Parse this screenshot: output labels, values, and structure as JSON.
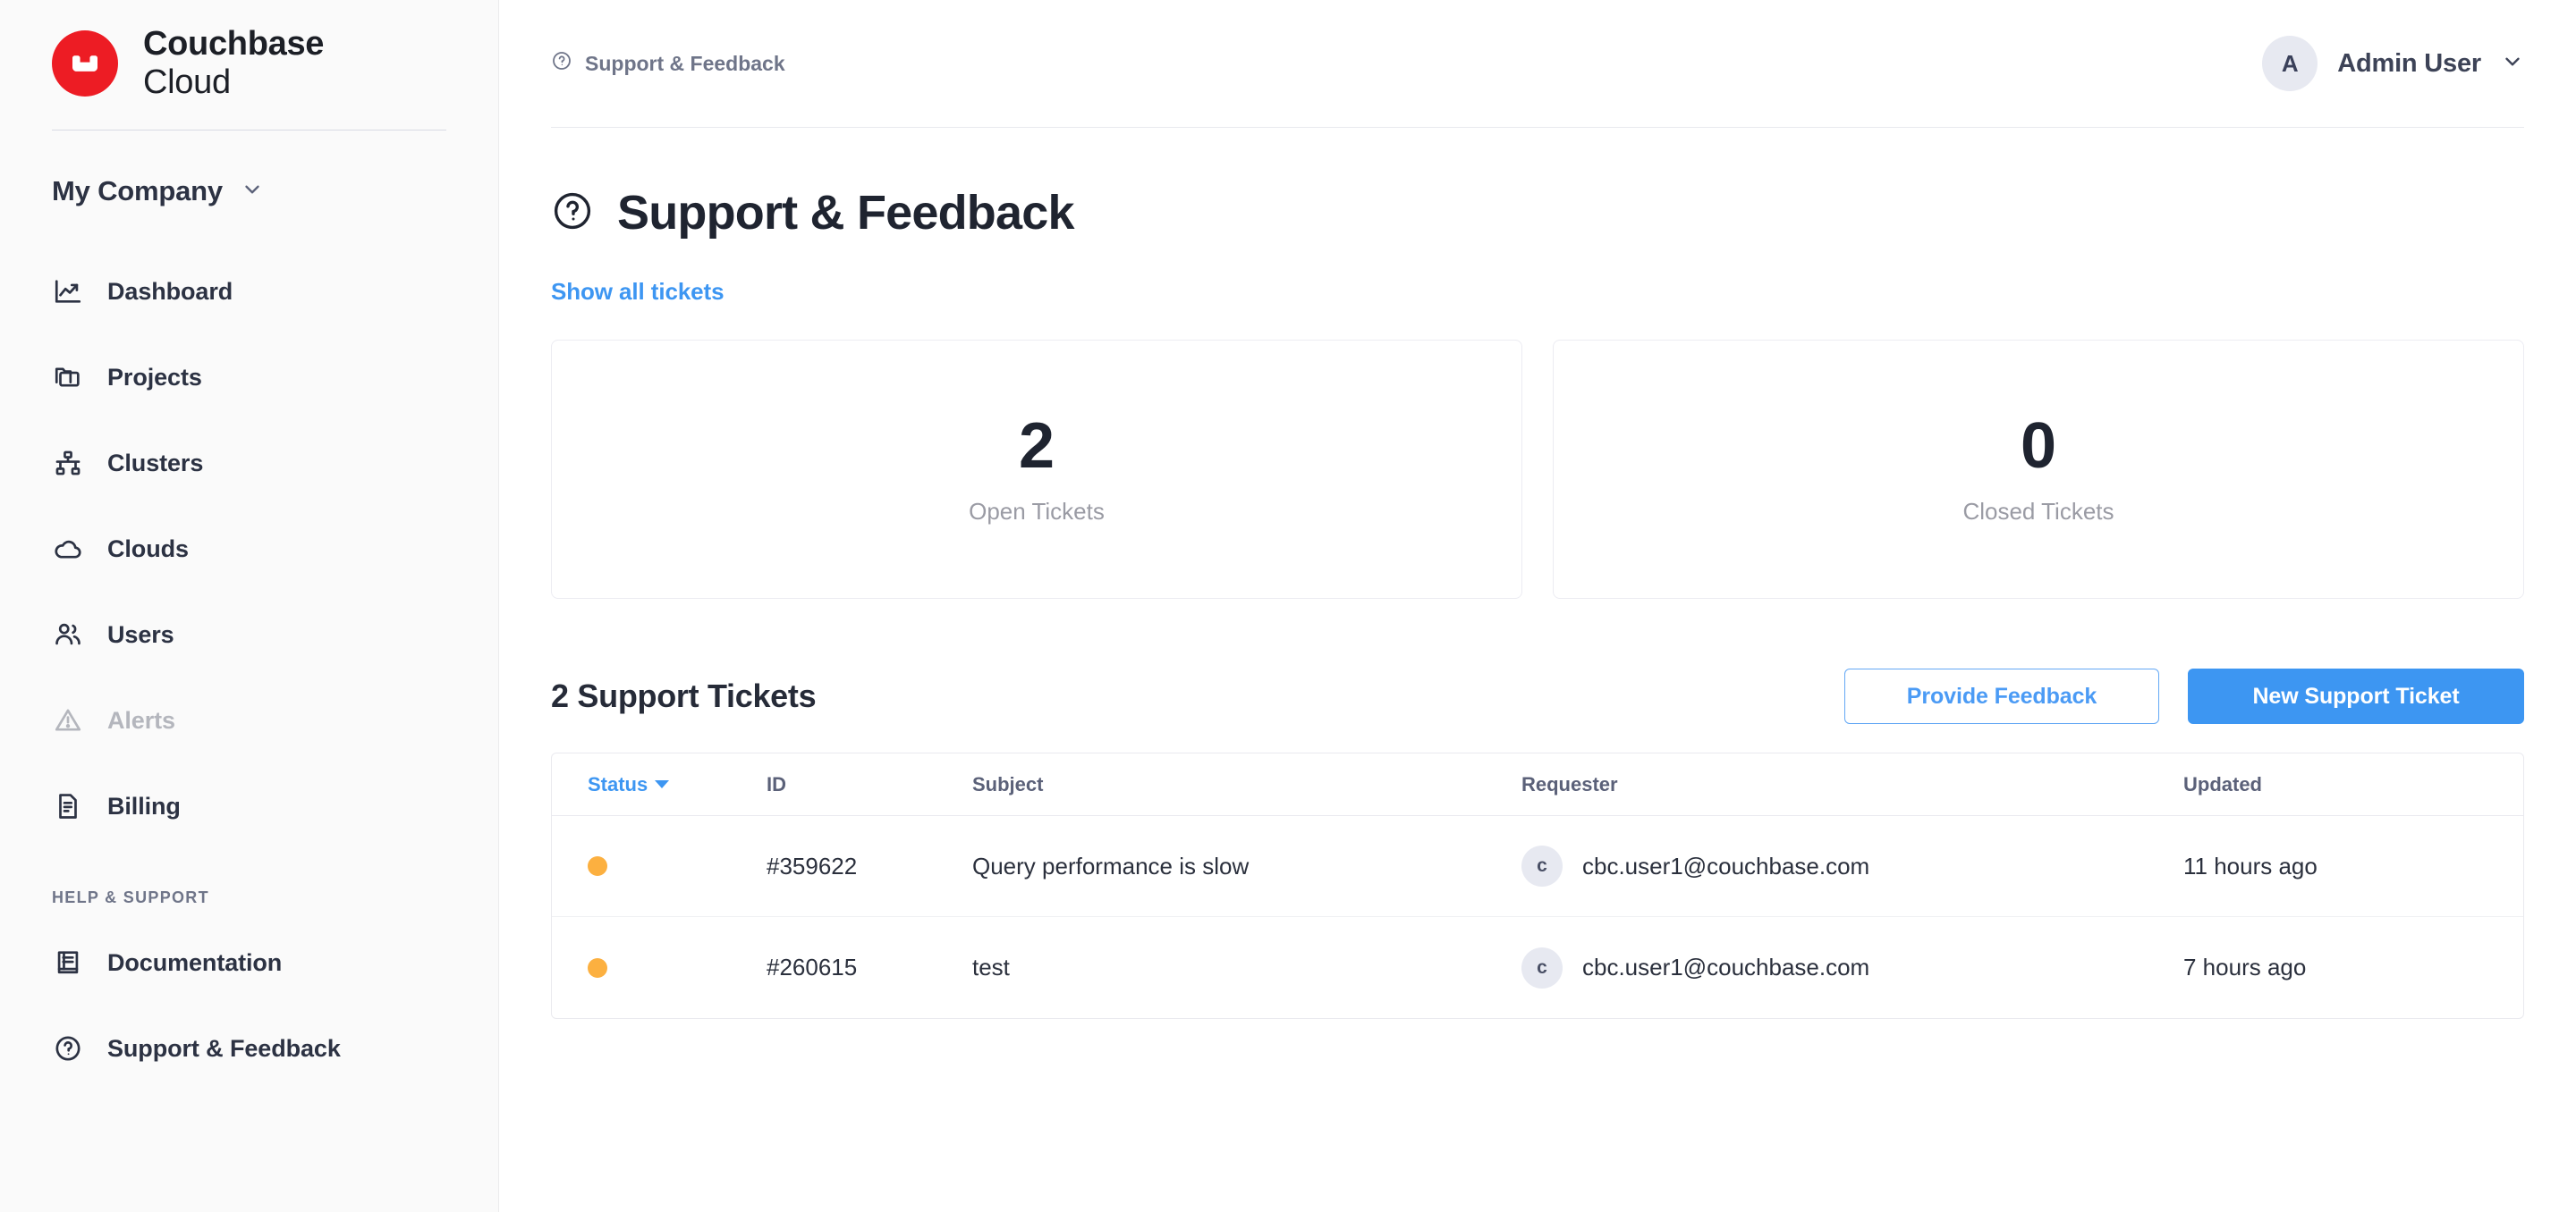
{
  "brand": {
    "name": "Couchbase",
    "sub": "Cloud",
    "logo_color": "#ED1C24"
  },
  "sidebar": {
    "org": {
      "label": "My Company",
      "chevron_icon": "chevron-down-icon"
    },
    "items": [
      {
        "label": "Dashboard",
        "icon": "chart-line-icon",
        "disabled": false
      },
      {
        "label": "Projects",
        "icon": "folders-icon",
        "disabled": false
      },
      {
        "label": "Clusters",
        "icon": "network-nodes-icon",
        "disabled": false
      },
      {
        "label": "Clouds",
        "icon": "cloud-icon",
        "disabled": false
      },
      {
        "label": "Users",
        "icon": "users-icon",
        "disabled": false
      },
      {
        "label": "Alerts",
        "icon": "alert-triangle-icon",
        "disabled": true
      },
      {
        "label": "Billing",
        "icon": "document-icon",
        "disabled": false
      }
    ],
    "section_title": "HELP & SUPPORT",
    "help_items": [
      {
        "label": "Documentation",
        "icon": "book-icon"
      },
      {
        "label": "Support & Feedback",
        "icon": "question-circle-icon"
      }
    ]
  },
  "topbar": {
    "breadcrumb": "Support & Feedback",
    "breadcrumb_icon": "question-circle-icon",
    "user": {
      "initial": "A",
      "name": "Admin User",
      "chevron_icon": "chevron-down-icon"
    }
  },
  "page": {
    "title": "Support & Feedback",
    "title_icon": "question-circle-icon",
    "show_all_link": "Show all tickets"
  },
  "stats": [
    {
      "value": "2",
      "label": "Open Tickets"
    },
    {
      "value": "0",
      "label": "Closed Tickets"
    }
  ],
  "tickets_section": {
    "heading": "2 Support Tickets",
    "provide_feedback_label": "Provide Feedback",
    "new_ticket_label": "New Support Ticket",
    "accent_color": "#3D96F2"
  },
  "table": {
    "columns": {
      "status": "Status",
      "id": "ID",
      "subject": "Subject",
      "requester": "Requester",
      "updated": "Updated"
    },
    "sorted_by": "Status",
    "sort_direction": "desc",
    "status_dot_color": "#FCB040",
    "rows": [
      {
        "status": "open",
        "id": "#359622",
        "subject": "Query performance is slow",
        "requester_initial": "c",
        "requester": "cbc.user1@couchbase.com",
        "updated": "11 hours ago"
      },
      {
        "status": "open",
        "id": "#260615",
        "subject": "test",
        "requester_initial": "c",
        "requester": "cbc.user1@couchbase.com",
        "updated": "7 hours ago"
      }
    ]
  }
}
